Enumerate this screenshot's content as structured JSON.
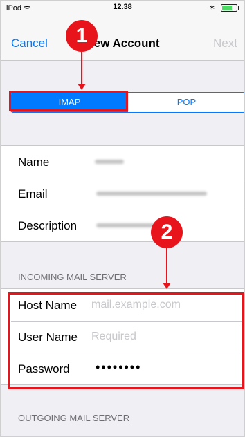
{
  "status_bar": {
    "carrier": "iPod ᯤ",
    "time": "12.38",
    "bluetooth": "∗"
  },
  "nav": {
    "cancel": "Cancel",
    "title": "New Account",
    "next": "Next"
  },
  "segment": {
    "options": [
      "IMAP",
      "POP"
    ],
    "selected": "IMAP"
  },
  "account": {
    "name_label": "Name",
    "email_label": "Email",
    "description_label": "Description"
  },
  "incoming": {
    "header": "INCOMING MAIL SERVER",
    "host_label": "Host Name",
    "host_placeholder": "mail.example.com",
    "user_label": "User Name",
    "user_placeholder": "Required",
    "password_label": "Password",
    "password_value": "••••••••"
  },
  "outgoing": {
    "header": "OUTGOING MAIL SERVER"
  },
  "callouts": {
    "one": "1",
    "two": "2"
  },
  "colors": {
    "accent": "#007aff",
    "highlight": "#e8141c"
  }
}
